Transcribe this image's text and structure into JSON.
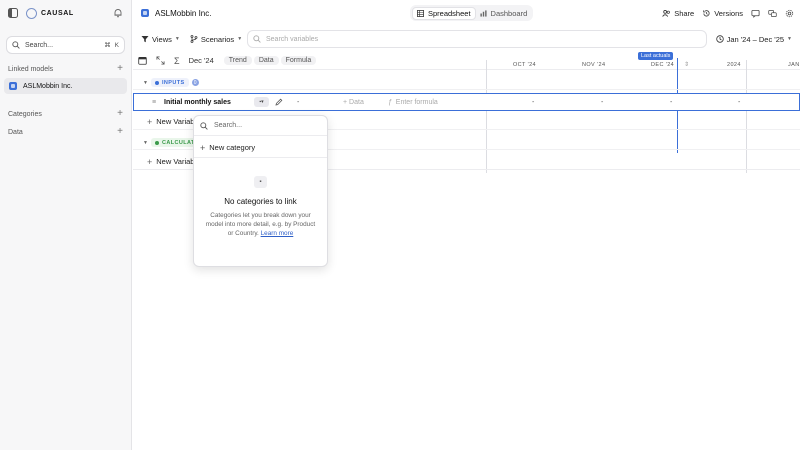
{
  "sidebar": {
    "brand": "CAUSAL",
    "search_label": "Search...",
    "search_shortcut": [
      "⌘",
      "K"
    ],
    "linked_models_label": "Linked models",
    "models": [
      {
        "label": "ASLMobbin Inc."
      }
    ],
    "categories_label": "Categories",
    "data_label": "Data"
  },
  "header": {
    "model_name": "ASLMobbin Inc.",
    "tabs": [
      {
        "label": "Spreadsheet",
        "active": true
      },
      {
        "label": "Dashboard",
        "active": false
      }
    ],
    "share_label": "Share",
    "versions_label": "Versions"
  },
  "toolbar": {
    "views_label": "Views",
    "scenarios_label": "Scenarios",
    "search_placeholder": "Search variables",
    "date_range": "Jan '24 – Dec '25"
  },
  "sheet": {
    "current_period": "Dec '24",
    "pills": [
      "Trend",
      "Data",
      "Formula"
    ],
    "columns": [
      "OCT '24",
      "NOV '24",
      "DEC '24",
      "2024",
      "JAN"
    ],
    "last_actuals": "Last actuals"
  },
  "groups": {
    "inputs": {
      "label": "INPUTS",
      "count": "0",
      "color": "#3b6fd8"
    },
    "calc": {
      "label": "CALCULAT",
      "color": "#3a9a4a"
    }
  },
  "variable": {
    "name": "Initial monthly sales",
    "value": "-",
    "data_label": "Data",
    "formula_placeholder": "Enter formula",
    "cells": [
      "-",
      "-",
      "-",
      "-"
    ]
  },
  "new_variable_label": "New Variab",
  "popover": {
    "search_placeholder": "Search...",
    "new_category_label": "New category",
    "empty_title": "No categories to link",
    "empty_desc": "Categories let you break down your model into more detail, e.g. by Product or Country.",
    "learn_more": "Learn more"
  }
}
